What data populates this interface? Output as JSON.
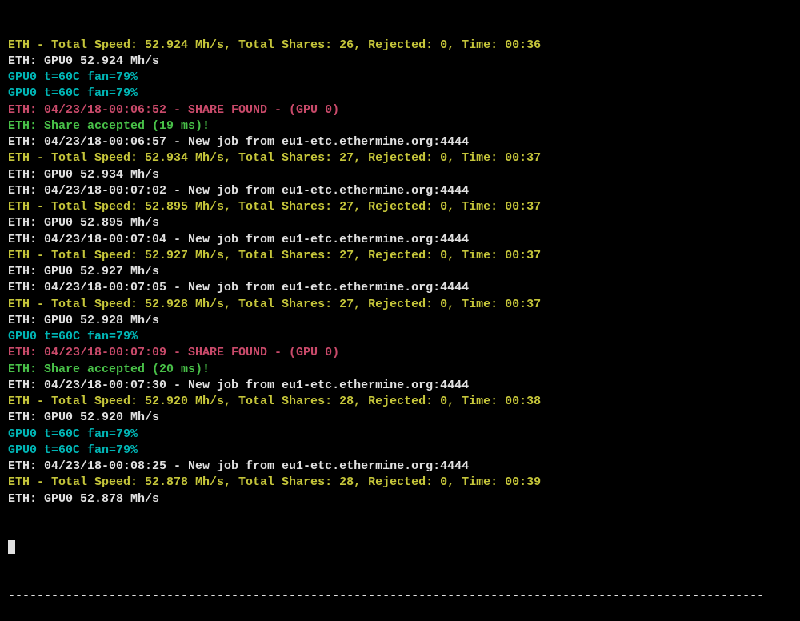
{
  "lines": [
    {
      "color": "yellow",
      "text": "ETH - Total Speed: 52.924 Mh/s, Total Shares: 26, Rejected: 0, Time: 00:36"
    },
    {
      "color": "white",
      "text": "ETH: GPU0 52.924 Mh/s"
    },
    {
      "color": "cyan",
      "text": "GPU0 t=60C fan=79%"
    },
    {
      "color": "cyan",
      "text": "GPU0 t=60C fan=79%"
    },
    {
      "color": "magenta",
      "text": "ETH: 04/23/18-00:06:52 - SHARE FOUND - (GPU 0)"
    },
    {
      "color": "green",
      "text": "ETH: Share accepted (19 ms)!"
    },
    {
      "color": "white",
      "text": "ETH: 04/23/18-00:06:57 - New job from eu1-etc.ethermine.org:4444"
    },
    {
      "color": "yellow",
      "text": "ETH - Total Speed: 52.934 Mh/s, Total Shares: 27, Rejected: 0, Time: 00:37"
    },
    {
      "color": "white",
      "text": "ETH: GPU0 52.934 Mh/s"
    },
    {
      "color": "white",
      "text": "ETH: 04/23/18-00:07:02 - New job from eu1-etc.ethermine.org:4444"
    },
    {
      "color": "yellow",
      "text": "ETH - Total Speed: 52.895 Mh/s, Total Shares: 27, Rejected: 0, Time: 00:37"
    },
    {
      "color": "white",
      "text": "ETH: GPU0 52.895 Mh/s"
    },
    {
      "color": "white",
      "text": "ETH: 04/23/18-00:07:04 - New job from eu1-etc.ethermine.org:4444"
    },
    {
      "color": "yellow",
      "text": "ETH - Total Speed: 52.927 Mh/s, Total Shares: 27, Rejected: 0, Time: 00:37"
    },
    {
      "color": "white",
      "text": "ETH: GPU0 52.927 Mh/s"
    },
    {
      "color": "white",
      "text": "ETH: 04/23/18-00:07:05 - New job from eu1-etc.ethermine.org:4444"
    },
    {
      "color": "yellow",
      "text": "ETH - Total Speed: 52.928 Mh/s, Total Shares: 27, Rejected: 0, Time: 00:37"
    },
    {
      "color": "white",
      "text": "ETH: GPU0 52.928 Mh/s"
    },
    {
      "color": "cyan",
      "text": "GPU0 t=60C fan=79%"
    },
    {
      "color": "magenta",
      "text": "ETH: 04/23/18-00:07:09 - SHARE FOUND - (GPU 0)"
    },
    {
      "color": "green",
      "text": "ETH: Share accepted (20 ms)!"
    },
    {
      "color": "white",
      "text": "ETH: 04/23/18-00:07:30 - New job from eu1-etc.ethermine.org:4444"
    },
    {
      "color": "yellow",
      "text": "ETH - Total Speed: 52.920 Mh/s, Total Shares: 28, Rejected: 0, Time: 00:38"
    },
    {
      "color": "white",
      "text": "ETH: GPU0 52.920 Mh/s"
    },
    {
      "color": "cyan",
      "text": "GPU0 t=60C fan=79%"
    },
    {
      "color": "cyan",
      "text": "GPU0 t=60C fan=79%"
    },
    {
      "color": "white",
      "text": "ETH: 04/23/18-00:08:25 - New job from eu1-etc.ethermine.org:4444"
    },
    {
      "color": "yellow",
      "text": "ETH - Total Speed: 52.878 Mh/s, Total Shares: 28, Rejected: 0, Time: 00:39"
    },
    {
      "color": "white",
      "text": "ETH: GPU0 52.878 Mh/s"
    }
  ],
  "separator": "---------------------------------------------------------------------------------------------------------"
}
